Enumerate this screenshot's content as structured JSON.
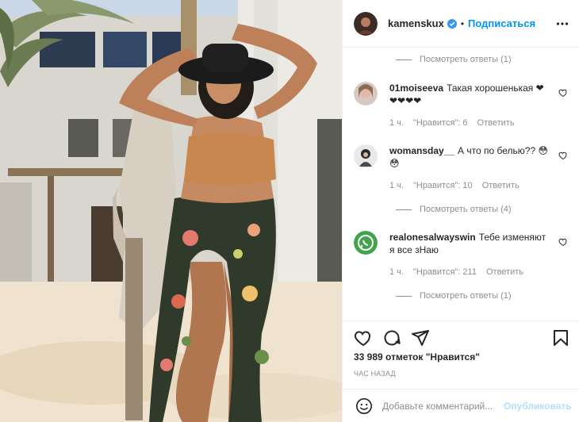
{
  "post": {
    "username": "kamenskux",
    "follow_label": "Подписаться",
    "separator": "•"
  },
  "comments": {
    "view_replies": [
      "Посмотреть ответы (1)",
      "Посмотреть ответы (4)",
      "Посмотреть ответы (1)"
    ],
    "items": [
      {
        "username": "01moiseeva",
        "text": "Такая хорошенькая ❤❤❤❤❤",
        "time": "1 ч.",
        "likes": "\"Нравится\": 6",
        "reply": "Ответить"
      },
      {
        "username": "womansday__",
        "text": "А что по белью?? 😳😳",
        "time": "1 ч.",
        "likes": "\"Нравится\": 10",
        "reply": "Ответить"
      },
      {
        "username": "realonesalwayswin",
        "text": "Тебе изменяют я все зНаю",
        "time": "1 ч.",
        "likes": "\"Нравится\": 211",
        "reply": "Ответить"
      }
    ]
  },
  "actions": {
    "like_count": "33 989 отметок \"Нравится\"",
    "time_ago": "ЧАС НАЗАД"
  },
  "add_comment": {
    "placeholder": "Добавьте комментарий...",
    "publish_label": "Опубликовать"
  },
  "colors": {
    "accent": "#0095f6",
    "publish_disabled": "#b2dffc",
    "secondary_text": "#8e8e8e",
    "border": "#efefef"
  }
}
